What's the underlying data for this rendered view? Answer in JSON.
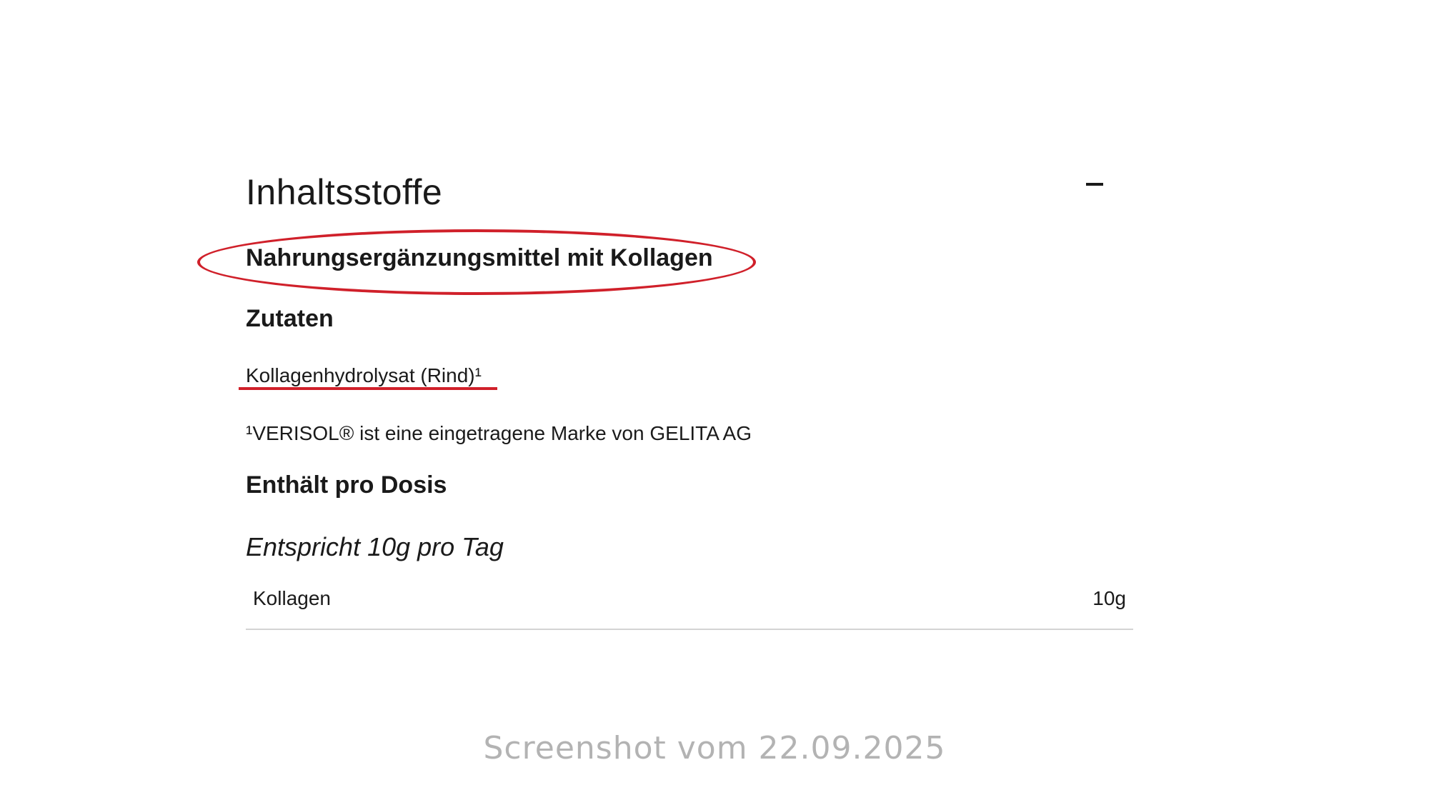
{
  "section": {
    "title": "Inhaltsstoffe",
    "collapse_icon": "minus-icon"
  },
  "product_type": "Nahrungsergänzungsmittel mit Kollagen",
  "ingredients": {
    "heading": "Zutaten",
    "text": "Kollagenhydrolysat (Rind)¹",
    "footnote": "¹VERISOL® ist eine eingetragene Marke von GELITA AG"
  },
  "dose": {
    "heading": "Enthält pro Dosis",
    "note": "Entspricht 10g pro Tag",
    "rows": [
      {
        "name": "Kollagen",
        "amount": "10g"
      }
    ]
  },
  "annotations": {
    "color": "#d0202a"
  },
  "caption": "Screenshot vom 22.09.2025"
}
